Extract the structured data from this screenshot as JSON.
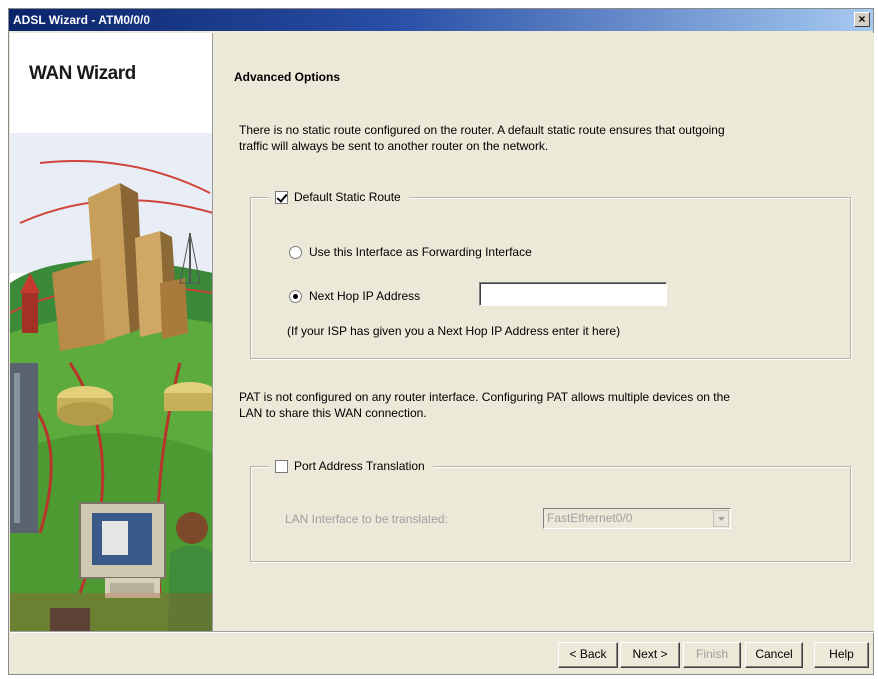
{
  "window": {
    "title": "ADSL Wizard - ATM0/0/0",
    "close_glyph": "×"
  },
  "sidebar": {
    "title": "WAN Wizard"
  },
  "page": {
    "heading": "Advanced Options",
    "static_route_info_line1": "There is no static route configured on the router. A default static route ensures that outgoing",
    "static_route_info_line2": "traffic will always be sent to another router on the network.",
    "static_route_group": {
      "label": "Default Static Route",
      "checked": true,
      "option_forwarding_interface": "Use this Interface as Forwarding Interface",
      "option_next_hop": "Next Hop IP Address",
      "selected_option": "next_hop",
      "next_hop_value": "",
      "hint": "(If your ISP has given you a Next Hop IP Address enter it here)"
    },
    "pat_info_line1": "PAT is not configured on any router interface. Configuring PAT allows multiple devices on the",
    "pat_info_line2": "LAN to share this WAN connection.",
    "pat_group": {
      "label": "Port Address Translation",
      "checked": false,
      "lan_interface_label": "LAN Interface to be translated:",
      "lan_interface_value": "FastEthernet0/0"
    }
  },
  "buttons": {
    "back": "< Back",
    "next": "Next >",
    "finish": "Finish",
    "cancel": "Cancel",
    "help": "Help"
  },
  "colors": {
    "titlebar_start": "#0a246a",
    "titlebar_end": "#a6caf0",
    "dialog_bg": "#ece9d8"
  }
}
